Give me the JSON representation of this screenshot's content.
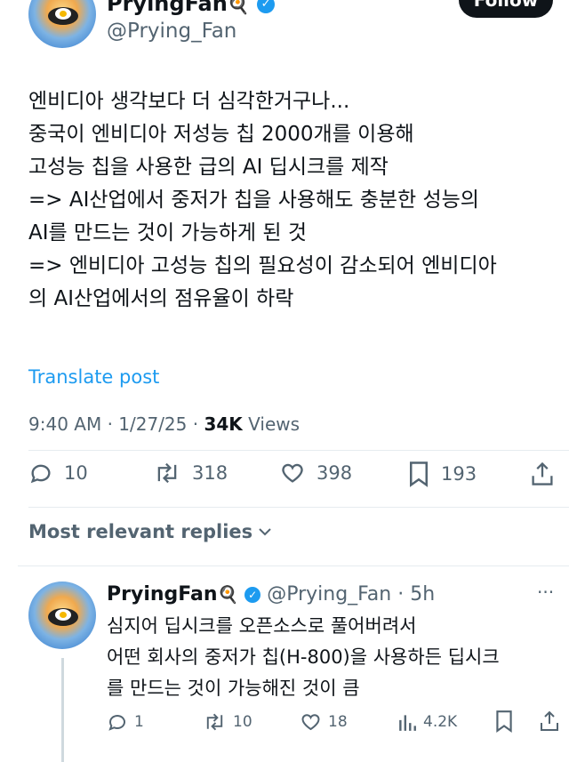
{
  "main_post": {
    "author_name": "PryingFan",
    "author_emoji": "🍳",
    "author_handle": "@Prying_Fan",
    "follow_label": "Follow",
    "text": "엔비디아 생각보다 더 심각한거구나...\n중국이 엔비디아 저성능 칩 2000개를 이용해\n고성능 칩을 사용한 급의 AI 딥시크를 제작\n=> AI산업에서 중저가 칩을 사용해도 충분한 성능의\nAI를 만드는 것이 가능하게 된 것\n=> 엔비디아 고성능 칩의 필요성이 감소되어 엔비디아\n의 AI산업에서의 점유율이 하락",
    "translate_label": "Translate post",
    "time": "9:40 AM · 1/27/25 · ",
    "views_count": "34K",
    "views_label": " Views",
    "actions": {
      "replies": "10",
      "reposts": "318",
      "likes": "398",
      "bookmarks": "193"
    }
  },
  "replies_filter": {
    "label": "Most relevant replies",
    "icon": "chevron-down-icon"
  },
  "reply": {
    "author_name": "PryingFan",
    "author_emoji": "🍳",
    "author_handle": "@Prying_Fan",
    "time": "· 5h",
    "more": "···",
    "text": "심지어 딥시크를 오픈소스로 풀어버려서\n어떤 회사의 중저가 칩(H-800)을 사용하든 딥시크\n를 만드는 것이 가능해진 것이 큼",
    "actions": {
      "replies": "1",
      "reposts": "10",
      "likes": "18",
      "views": "4.2K"
    }
  },
  "colors": {
    "accent": "#1d9bf0",
    "text": "#0f1419",
    "muted": "#536471"
  }
}
